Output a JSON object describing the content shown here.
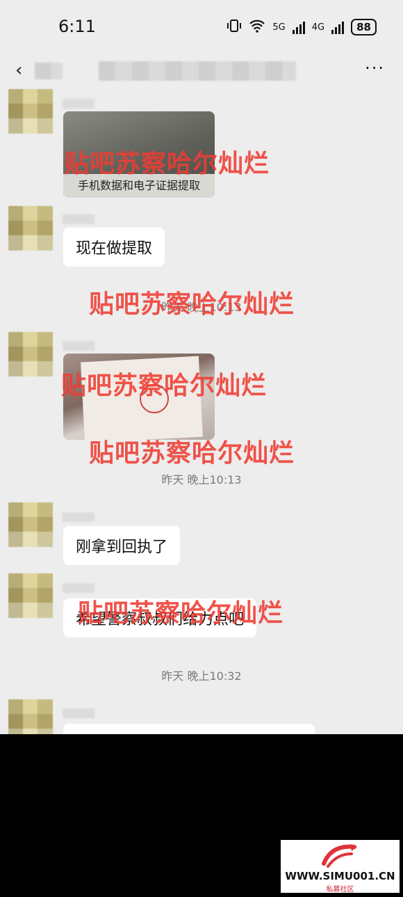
{
  "status": {
    "time": "6:11",
    "net1": "5G",
    "net2": "4G",
    "battery": "88"
  },
  "topbar": {
    "back_glyph": "‹",
    "more_glyph": "···"
  },
  "messages": {
    "img1_caption": "手机数据和电子证据提取",
    "bubble_1": "现在做提取",
    "bubble_2": "刚拿到回执了",
    "bubble_3": "希望警察叔叔们给力点吧"
  },
  "timestamps": {
    "t1": "昨天 晚上10:13",
    "t2": "昨天 晚上10:13",
    "t3": "昨天 晚上10:32"
  },
  "watermark_text": "贴吧苏察哈尔灿烂",
  "logo": {
    "url_text": "WWW.SIMU001.CN",
    "sub_text": "私募社区"
  },
  "colors": {
    "watermark": "#ee3c32",
    "chat_bg": "#ededed"
  }
}
